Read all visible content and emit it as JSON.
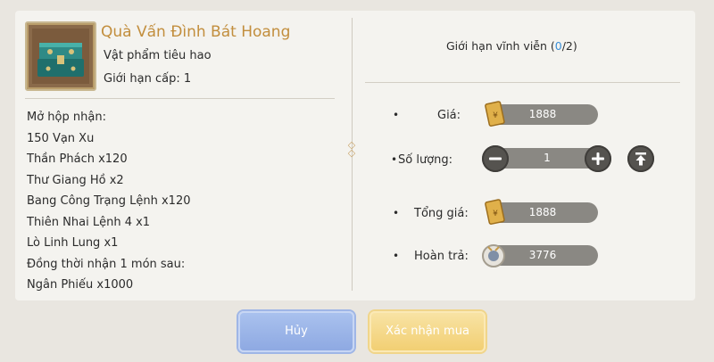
{
  "item": {
    "name": "Quà Vấn Đình Bát Hoang",
    "type": "Vật phẩm tiêu hao",
    "level_limit": "Giới hạn cấp: 1"
  },
  "contents": [
    "Mở hộp nhận:",
    "150 Vạn Xu",
    "Thần Phách x120",
    "Thư Giang Hồ x2",
    "Bang Công Trạng Lệnh x120",
    "Thiên Nhai Lệnh 4 x1",
    "Lò Linh Lung x1",
    "Đồng thời nhận 1 món sau:",
    "Ngân Phiếu x1000"
  ],
  "limit": {
    "prefix": "Giới hạn vĩnh viễn (",
    "bought": "0",
    "suffix": "/2)"
  },
  "purchase": {
    "price_label": "Giá:",
    "price_value": "1888",
    "quantity_label": "Số lượng:",
    "quantity_value": "1",
    "total_label": "Tổng giá:",
    "total_value": "1888",
    "refund_label": "Hoàn trả:",
    "refund_value": "3776",
    "bullet": "•"
  },
  "buttons": {
    "cancel": "Hủy",
    "confirm": "Xác nhận mua"
  },
  "colors": {
    "title": "#c28e3d",
    "limit_count": "#3a8fd8",
    "cancel_button": "#9fb6e6",
    "confirm_button": "#f2cf73"
  },
  "icons": {
    "price_currency": "gold-ticket-icon",
    "refund_currency": "silver-coin-icon",
    "minus": "minus-icon",
    "plus": "plus-icon",
    "max": "max-quantity-icon"
  }
}
